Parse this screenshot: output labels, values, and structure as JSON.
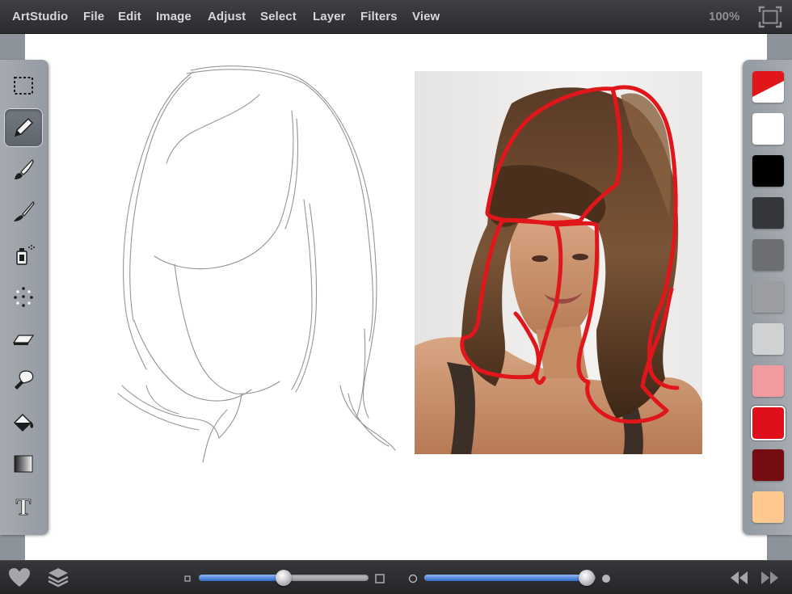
{
  "app": {
    "name": "ArtStudio",
    "menus": [
      "File",
      "Edit",
      "Image",
      "Adjust",
      "Select",
      "Layer",
      "Filters",
      "View"
    ],
    "zoom": "100%"
  },
  "tools": [
    {
      "name": "marquee-select",
      "icon": "dashed-rect-icon",
      "active": false
    },
    {
      "name": "pencil",
      "icon": "pencil-icon",
      "active": true
    },
    {
      "name": "brush",
      "icon": "brush-icon",
      "active": false
    },
    {
      "name": "fine-brush",
      "icon": "fine-brush-icon",
      "active": false
    },
    {
      "name": "spray",
      "icon": "spray-can-icon",
      "active": false
    },
    {
      "name": "scatter",
      "icon": "scatter-dots-icon",
      "active": false
    },
    {
      "name": "eraser",
      "icon": "eraser-icon",
      "active": false
    },
    {
      "name": "smudge",
      "icon": "smudge-finger-icon",
      "active": false
    },
    {
      "name": "fill",
      "icon": "paint-bucket-icon",
      "active": false
    },
    {
      "name": "gradient",
      "icon": "gradient-icon",
      "active": false
    },
    {
      "name": "text",
      "icon": "text-icon",
      "active": false
    }
  ],
  "colors": {
    "current": {
      "primary": "#e0161b",
      "secondary": "#ffffff"
    },
    "swatches": [
      "#ffffff",
      "#000000",
      "#36373b",
      "#6c6e72",
      "#9b9da0",
      "#d0d1d2",
      "#f19aa0",
      "#e0101a",
      "#740c12",
      "#fec98e"
    ],
    "selected_index": 7
  },
  "sliders": {
    "brush_size": {
      "value": 0.5
    },
    "opacity": {
      "value": 0.95
    }
  },
  "bottom_icons": {
    "favorite": "heart-icon",
    "layers": "layers-icon",
    "undo": "rewind-icon",
    "redo": "fast-forward-icon"
  },
  "theme": {
    "outline_color": "#e0161b",
    "slider_fill": "#2e69c9"
  }
}
